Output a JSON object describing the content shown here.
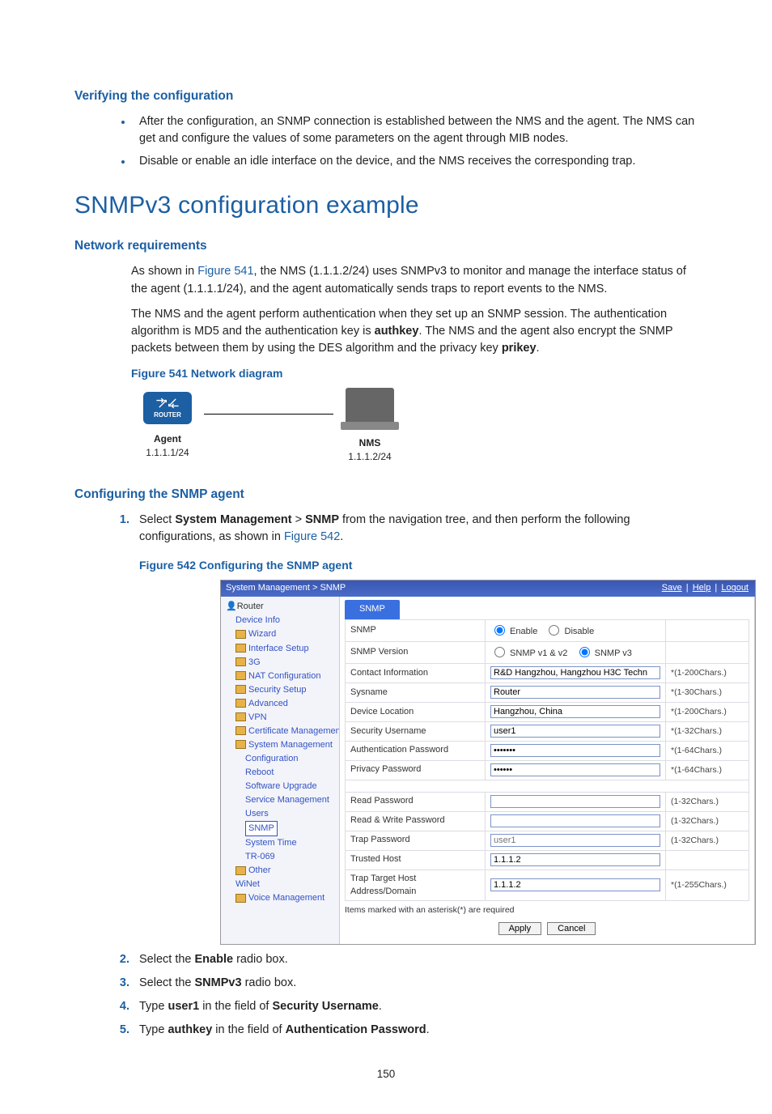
{
  "sections": {
    "verify_title": "Verifying the configuration",
    "verify_b1": "After the configuration, an SNMP connection is established between the NMS and the agent. The NMS can get and configure the values of some parameters on the agent through MIB nodes.",
    "verify_b2": "Disable or enable an idle interface on the device, and the NMS receives the corresponding trap.",
    "example_title": "SNMPv3 configuration example",
    "netreq_title": "Network requirements",
    "netreq_p1a": "As shown in ",
    "netreq_p1_link": "Figure 541",
    "netreq_p1b": ", the NMS (1.1.1.2/24) uses SNMPv3 to monitor and manage the interface status of the agent (1.1.1.1/24), and the agent automatically sends traps to report events to the NMS.",
    "netreq_p2a": "The NMS and the agent perform authentication when they set up an SNMP session. The authentication algorithm is MD5 and the authentication key is ",
    "netreq_p2_b1": "authkey",
    "netreq_p2b": ". The NMS and the agent also encrypt the SNMP packets between them by using the DES algorithm and the privacy key ",
    "netreq_p2_b2": "prikey",
    "netreq_p2c": ".",
    "fig541_caption": "Figure 541 Network diagram",
    "diagram": {
      "agent_label": "Agent",
      "agent_ip": "1.1.1.1/24",
      "router_label": "ROUTER",
      "nms_label": "NMS",
      "nms_ip": "1.1.1.2/24"
    },
    "config_title": "Configuring the SNMP agent",
    "step1a": "Select ",
    "step1_b1": "System Management",
    "step1_gt": " > ",
    "step1_b2": "SNMP",
    "step1b": " from the navigation tree, and then perform the following configurations, as shown in ",
    "step1_link": "Figure 542",
    "step1c": ".",
    "fig542_caption": "Figure 542 Configuring the SNMP agent",
    "step2a": "Select the ",
    "step2_b": "Enable",
    "step2b": " radio box.",
    "step3a": "Select the ",
    "step3_b": "SNMPv3",
    "step3b": " radio box.",
    "step4a": "Type ",
    "step4_b1": "user1",
    "step4b": " in the field of ",
    "step4_b2": "Security Username",
    "step4c": ".",
    "step5a": "Type ",
    "step5_b1": "authkey",
    "step5b": " in the field of ",
    "step5_b2": "Authentication Password",
    "step5c": "."
  },
  "screenshot": {
    "breadcrumb": "System Management > SNMP",
    "top_links": {
      "save": "Save",
      "help": "Help",
      "logout": "Logout"
    },
    "tree": {
      "root": "Router",
      "items": [
        {
          "t": "Device Info",
          "cls": "indent1"
        },
        {
          "t": "Wizard",
          "cls": "indent1",
          "folder": true
        },
        {
          "t": "Interface Setup",
          "cls": "indent1",
          "folder": true
        },
        {
          "t": "3G",
          "cls": "indent1",
          "folder": true
        },
        {
          "t": "NAT Configuration",
          "cls": "indent1",
          "folder": true
        },
        {
          "t": "Security Setup",
          "cls": "indent1",
          "folder": true
        },
        {
          "t": "Advanced",
          "cls": "indent1",
          "folder": true
        },
        {
          "t": "VPN",
          "cls": "indent1",
          "folder": true
        },
        {
          "t": "Certificate Management",
          "cls": "indent1",
          "folder": true
        },
        {
          "t": "System Management",
          "cls": "indent1",
          "folder": true
        },
        {
          "t": "Configuration",
          "cls": "indent2"
        },
        {
          "t": "Reboot",
          "cls": "indent2"
        },
        {
          "t": "Software Upgrade",
          "cls": "indent2"
        },
        {
          "t": "Service Management",
          "cls": "indent2"
        },
        {
          "t": "Users",
          "cls": "indent2"
        },
        {
          "t": "SNMP",
          "cls": "indent2",
          "sel": true
        },
        {
          "t": "System Time",
          "cls": "indent2"
        },
        {
          "t": "TR-069",
          "cls": "indent2"
        },
        {
          "t": "Other",
          "cls": "indent1",
          "folder": true
        },
        {
          "t": "WiNet",
          "cls": "indent1"
        },
        {
          "t": "Voice Management",
          "cls": "indent1",
          "folder": true
        }
      ]
    },
    "tab": "SNMP",
    "form": {
      "rows": [
        {
          "label": "SNMP",
          "type": "radio2",
          "opt1": "Enable",
          "opt2": "Disable",
          "sel": 1,
          "help": ""
        },
        {
          "label": "SNMP Version",
          "type": "radio2",
          "opt1": "SNMP v1 & v2",
          "opt2": "SNMP v3",
          "sel": 2,
          "help": ""
        },
        {
          "label": "Contact Information",
          "type": "text",
          "value": "R&D Hangzhou, Hangzhou H3C Techn",
          "help": "*(1-200Chars.)"
        },
        {
          "label": "Sysname",
          "type": "text",
          "value": "Router",
          "help": "*(1-30Chars.)"
        },
        {
          "label": "Device Location",
          "type": "text",
          "value": "Hangzhou, China",
          "help": "*(1-200Chars.)"
        },
        {
          "label": "Security Username",
          "type": "text",
          "value": "user1",
          "help": "*(1-32Chars.)"
        },
        {
          "label": "Authentication Password",
          "type": "password",
          "value": "•••••••",
          "help": "*(1-64Chars.)"
        },
        {
          "label": "Privacy Password",
          "type": "password",
          "value": "••••••",
          "help": "*(1-64Chars.)"
        },
        {
          "label": "__spacer"
        },
        {
          "label": "Read Password",
          "type": "text",
          "value": "",
          "help": "(1-32Chars.)"
        },
        {
          "label": "Read & Write Password",
          "type": "text",
          "value": "",
          "help": "(1-32Chars.)"
        },
        {
          "label": "Trap Password",
          "type": "text",
          "value": "user1",
          "ph": true,
          "help": "(1-32Chars.)"
        },
        {
          "label": "Trusted Host",
          "type": "text",
          "value": "1.1.1.2",
          "help": ""
        },
        {
          "label": "Trap Target Host Address/Domain",
          "type": "text",
          "value": "1.1.1.2",
          "help": "*(1-255Chars.)"
        }
      ],
      "note": "Items marked with an asterisk(*) are required",
      "apply": "Apply",
      "cancel": "Cancel"
    }
  },
  "page_number": "150"
}
